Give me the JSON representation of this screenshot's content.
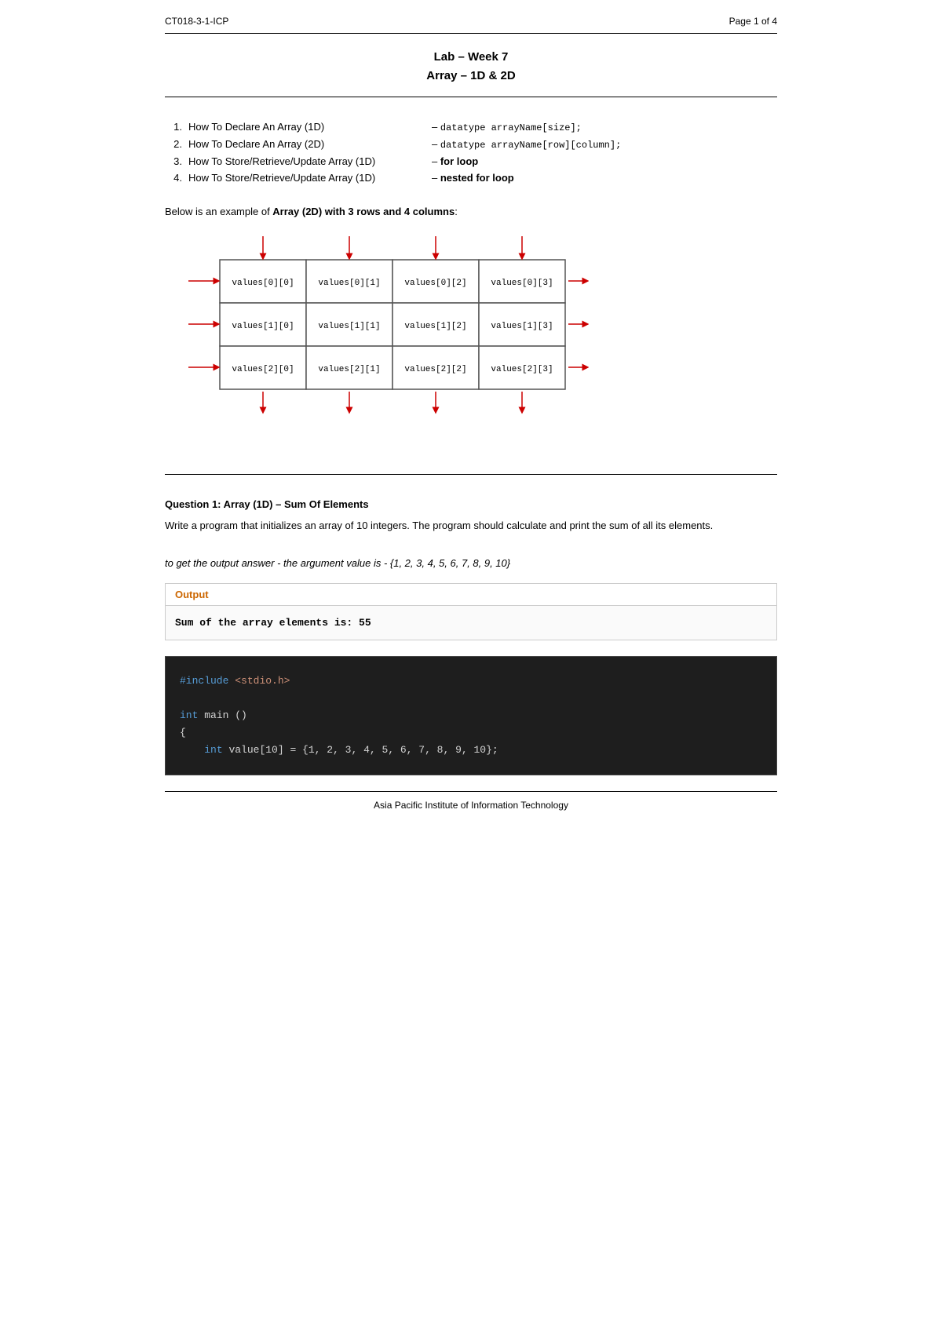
{
  "header": {
    "left": "CT018-3-1-ICP",
    "right": "Page 1 of 4"
  },
  "title": {
    "line1": "Lab – Week 7",
    "line2": "Array – 1D & 2D"
  },
  "toc": {
    "items": [
      {
        "num": "1.",
        "label": "How To Declare An Array (1D)",
        "desc": "– datatype arrayName[size];"
      },
      {
        "num": "2.",
        "label": "How To Declare An Array (2D)",
        "desc": "– datatype arrayName[row][column];"
      },
      {
        "num": "3.",
        "label": "How To Store/Retrieve/Update Array (1D)",
        "desc": "– for loop"
      },
      {
        "num": "4.",
        "label": "How To Store/Retrieve/Update Array (1D)",
        "desc": "– nested for loop"
      }
    ]
  },
  "diagram": {
    "intro": "Below is an example of Array (2D) with 3 rows and 4 columns:",
    "cells": [
      [
        "values[0][0]",
        "values[0][1]",
        "values[0][2]",
        "values[0][3]"
      ],
      [
        "values[1][0]",
        "values[1][1]",
        "values[1][2]",
        "values[1][3]"
      ],
      [
        "values[2][0]",
        "values[2][1]",
        "values[2][2]",
        "values[2][3]"
      ]
    ]
  },
  "question1": {
    "title": "Question 1: Array (1D) – Sum Of Elements",
    "body": "Write a program that initializes an array of 10 integers. The program should calculate and print the sum of all its elements.",
    "hint": "to get the output answer - the argument value is - {1, 2, 3, 4, 5, 6, 7, 8, 9, 10}",
    "output_label": "Output",
    "output_text": "Sum of the array elements is: 55"
  },
  "code": {
    "lines": [
      "#include <stdio.h>",
      "",
      "int main ()",
      "{",
      "    int value[10] = {1, 2, 3, 4, 5, 6, 7, 8, 9, 10};"
    ]
  },
  "footer": {
    "text": "Asia Pacific Institute of Information Technology"
  }
}
